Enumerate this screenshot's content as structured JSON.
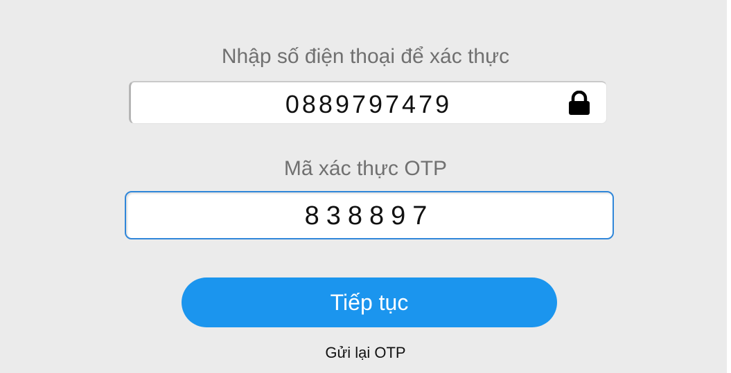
{
  "phone": {
    "label": "Nhập số điện thoại để xác thực",
    "value": "0889797479",
    "icon": "lock-icon"
  },
  "otp": {
    "label": "Mã xác thực OTP",
    "value": "838897"
  },
  "actions": {
    "continue_label": "Tiếp tục",
    "resend_label": "Gửi lại OTP"
  },
  "colors": {
    "background": "#ebebeb",
    "accent": "#1b95ee",
    "focus_border": "#2f86d9"
  }
}
